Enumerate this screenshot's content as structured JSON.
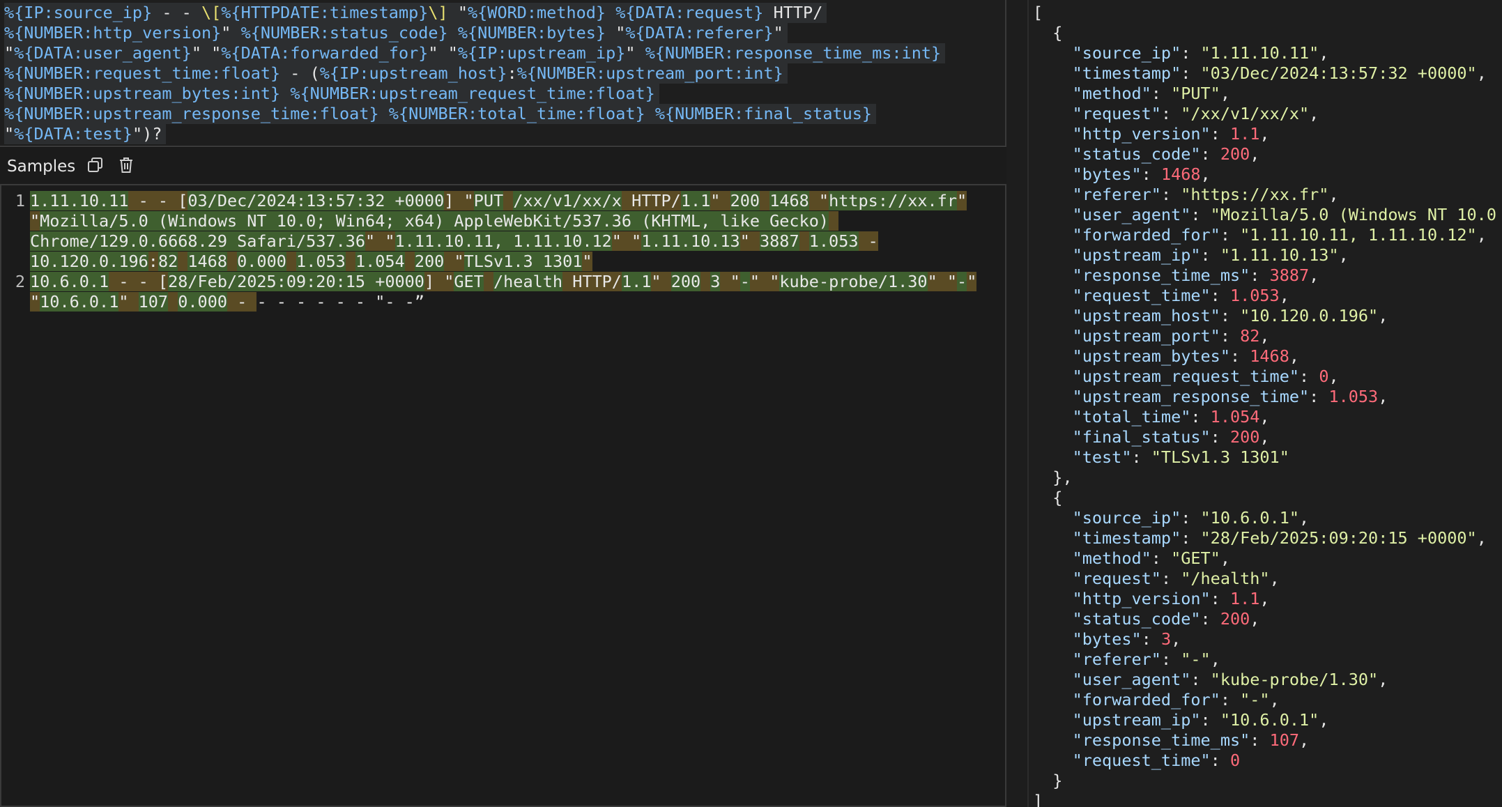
{
  "pattern": {
    "lines": [
      [
        [
          "g",
          "%{IP:source_ip}"
        ],
        [
          "t",
          " - - "
        ],
        [
          "esc",
          "\\["
        ],
        [
          "g",
          "%{HTTPDATE:timestamp}"
        ],
        [
          "esc",
          "\\]"
        ],
        [
          "t",
          " \""
        ],
        [
          "g",
          "%{WORD:method}"
        ],
        [
          "t",
          " "
        ],
        [
          "g",
          "%{DATA:request}"
        ],
        [
          "t",
          " HTTP/"
        ]
      ],
      [
        [
          "g",
          "%{NUMBER:http_version}"
        ],
        [
          "t",
          "\" "
        ],
        [
          "g",
          "%{NUMBER:status_code}"
        ],
        [
          "t",
          " "
        ],
        [
          "g",
          "%{NUMBER:bytes}"
        ],
        [
          "t",
          " \""
        ],
        [
          "g",
          "%{DATA:referer}"
        ],
        [
          "t",
          "\""
        ]
      ],
      [
        [
          "t",
          "\""
        ],
        [
          "g",
          "%{DATA:user_agent}"
        ],
        [
          "t",
          "\" \""
        ],
        [
          "g",
          "%{DATA:forwarded_for}"
        ],
        [
          "t",
          "\" \""
        ],
        [
          "g",
          "%{IP:upstream_ip}"
        ],
        [
          "t",
          "\" "
        ],
        [
          "g",
          "%{NUMBER:response_time_ms:int}"
        ]
      ],
      [
        [
          "g",
          "%{NUMBER:request_time:float}"
        ],
        [
          "t",
          " - ("
        ],
        [
          "g",
          "%{IP:upstream_host}"
        ],
        [
          "t",
          ":"
        ],
        [
          "g",
          "%{NUMBER:upstream_port:int}"
        ]
      ],
      [
        [
          "g",
          "%{NUMBER:upstream_bytes:int}"
        ],
        [
          "t",
          " "
        ],
        [
          "g",
          "%{NUMBER:upstream_request_time:float}"
        ]
      ],
      [
        [
          "g",
          "%{NUMBER:upstream_response_time:float}"
        ],
        [
          "t",
          " "
        ],
        [
          "g",
          "%{NUMBER:total_time:float}"
        ],
        [
          "t",
          " "
        ],
        [
          "g",
          "%{NUMBER:final_status}"
        ]
      ],
      [
        [
          "t",
          "\""
        ],
        [
          "g",
          "%{DATA:test}"
        ],
        [
          "t",
          "\")?"
        ]
      ]
    ]
  },
  "samples": {
    "title": "Samples",
    "copy_icon": "copy-icon",
    "delete_icon": "trash-icon",
    "entries": [
      {
        "number": "1",
        "lines": [
          [
            [
              "m",
              "1.11.10.11"
            ],
            [
              "s",
              " - - ["
            ],
            [
              "m",
              "03/Dec/2024:13:57:32 +0000"
            ],
            [
              "s",
              "] \""
            ],
            [
              "m",
              "PUT"
            ],
            [
              "s",
              " "
            ],
            [
              "m",
              "/xx/v1/xx/x"
            ],
            [
              "s",
              " HTTP/"
            ],
            [
              "m",
              "1.1"
            ],
            [
              "s",
              "\" "
            ],
            [
              "m",
              "200"
            ],
            [
              "s",
              " "
            ],
            [
              "m",
              "1468"
            ],
            [
              "s",
              " \""
            ],
            [
              "m",
              "https://xx.fr"
            ],
            [
              "s",
              "\""
            ]
          ],
          [
            [
              "s",
              "\""
            ],
            [
              "m",
              "Mozilla/5.0 (Windows NT 10.0; Win64; x64) AppleWebKit/537.36 (KHTML, like Gecko)"
            ],
            [
              "s",
              " "
            ]
          ],
          [
            [
              "m",
              "Chrome/129.0.6668.29 Safari/537.36"
            ],
            [
              "s",
              "\" \""
            ],
            [
              "m",
              "1.11.10.11, 1.11.10.12"
            ],
            [
              "s",
              "\" \""
            ],
            [
              "m",
              "1.11.10.13"
            ],
            [
              "s",
              "\" "
            ],
            [
              "m",
              "3887"
            ],
            [
              "s",
              " "
            ],
            [
              "m",
              "1.053"
            ],
            [
              "s",
              " -"
            ]
          ],
          [
            [
              "m",
              "10.120.0.196"
            ],
            [
              "s",
              ":"
            ],
            [
              "m",
              "82"
            ],
            [
              "s",
              " "
            ],
            [
              "m",
              "1468"
            ],
            [
              "s",
              " "
            ],
            [
              "m",
              "0.000"
            ],
            [
              "s",
              " "
            ],
            [
              "m",
              "1.053"
            ],
            [
              "s",
              " "
            ],
            [
              "m",
              "1.054"
            ],
            [
              "s",
              " "
            ],
            [
              "m",
              "200"
            ],
            [
              "s",
              " \""
            ],
            [
              "m",
              "TLSv1.3 1301"
            ],
            [
              "s",
              "\""
            ]
          ]
        ]
      },
      {
        "number": "2",
        "lines": [
          [
            [
              "m",
              "10.6.0.1"
            ],
            [
              "s",
              " - - ["
            ],
            [
              "m",
              "28/Feb/2025:09:20:15 +0000"
            ],
            [
              "s",
              "] \""
            ],
            [
              "m",
              "GET"
            ],
            [
              "s",
              " "
            ],
            [
              "m",
              "/health"
            ],
            [
              "s",
              " HTTP/"
            ],
            [
              "m",
              "1.1"
            ],
            [
              "s",
              "\" "
            ],
            [
              "m",
              "200"
            ],
            [
              "s",
              " "
            ],
            [
              "m",
              "3"
            ],
            [
              "s",
              " \""
            ],
            [
              "m",
              "-"
            ],
            [
              "s",
              "\" \""
            ],
            [
              "m",
              "kube-probe/1.30"
            ],
            [
              "s",
              "\" \""
            ],
            [
              "m",
              "-"
            ],
            [
              "s",
              "\""
            ]
          ],
          [
            [
              "s",
              "\""
            ],
            [
              "m",
              "10.6.0.1"
            ],
            [
              "s",
              "\" "
            ],
            [
              "m",
              "107"
            ],
            [
              "s",
              " "
            ],
            [
              "m",
              "0.000"
            ],
            [
              "s",
              " - "
            ],
            [
              "t",
              "- - - - - - \"- -”"
            ]
          ]
        ]
      }
    ]
  },
  "output": {
    "lines": [
      [
        [
          "t",
          "["
        ]
      ],
      [
        [
          "t",
          "  {"
        ]
      ],
      [
        [
          "t",
          "    "
        ],
        [
          "k",
          "\"source_ip\""
        ],
        [
          "t",
          ": "
        ],
        [
          "sv",
          "\"1.11.10.11\""
        ],
        [
          "t",
          ","
        ]
      ],
      [
        [
          "t",
          "    "
        ],
        [
          "k",
          "\"timestamp\""
        ],
        [
          "t",
          ": "
        ],
        [
          "sv",
          "\"03/Dec/2024:13:57:32 +0000\""
        ],
        [
          "t",
          ","
        ]
      ],
      [
        [
          "t",
          "    "
        ],
        [
          "k",
          "\"method\""
        ],
        [
          "t",
          ": "
        ],
        [
          "sv",
          "\"PUT\""
        ],
        [
          "t",
          ","
        ]
      ],
      [
        [
          "t",
          "    "
        ],
        [
          "k",
          "\"request\""
        ],
        [
          "t",
          ": "
        ],
        [
          "sv",
          "\"/xx/v1/xx/x\""
        ],
        [
          "t",
          ","
        ]
      ],
      [
        [
          "t",
          "    "
        ],
        [
          "k",
          "\"http_version\""
        ],
        [
          "t",
          ": "
        ],
        [
          "nv",
          "1.1"
        ],
        [
          "t",
          ","
        ]
      ],
      [
        [
          "t",
          "    "
        ],
        [
          "k",
          "\"status_code\""
        ],
        [
          "t",
          ": "
        ],
        [
          "nv",
          "200"
        ],
        [
          "t",
          ","
        ]
      ],
      [
        [
          "t",
          "    "
        ],
        [
          "k",
          "\"bytes\""
        ],
        [
          "t",
          ": "
        ],
        [
          "nv",
          "1468"
        ],
        [
          "t",
          ","
        ]
      ],
      [
        [
          "t",
          "    "
        ],
        [
          "k",
          "\"referer\""
        ],
        [
          "t",
          ": "
        ],
        [
          "sv",
          "\"https://xx.fr\""
        ],
        [
          "t",
          ","
        ]
      ],
      [
        [
          "t",
          "    "
        ],
        [
          "k",
          "\"user_agent\""
        ],
        [
          "t",
          ": "
        ],
        [
          "sv",
          "\"Mozilla/5.0 (Windows NT 10.0"
        ]
      ],
      [
        [
          "t",
          "    "
        ],
        [
          "k",
          "\"forwarded_for\""
        ],
        [
          "t",
          ": "
        ],
        [
          "sv",
          "\"1.11.10.11, 1.11.10.12\""
        ],
        [
          "t",
          ","
        ]
      ],
      [
        [
          "t",
          "    "
        ],
        [
          "k",
          "\"upstream_ip\""
        ],
        [
          "t",
          ": "
        ],
        [
          "sv",
          "\"1.11.10.13\""
        ],
        [
          "t",
          ","
        ]
      ],
      [
        [
          "t",
          "    "
        ],
        [
          "k",
          "\"response_time_ms\""
        ],
        [
          "t",
          ": "
        ],
        [
          "nv",
          "3887"
        ],
        [
          "t",
          ","
        ]
      ],
      [
        [
          "t",
          "    "
        ],
        [
          "k",
          "\"request_time\""
        ],
        [
          "t",
          ": "
        ],
        [
          "nv",
          "1.053"
        ],
        [
          "t",
          ","
        ]
      ],
      [
        [
          "t",
          "    "
        ],
        [
          "k",
          "\"upstream_host\""
        ],
        [
          "t",
          ": "
        ],
        [
          "sv",
          "\"10.120.0.196\""
        ],
        [
          "t",
          ","
        ]
      ],
      [
        [
          "t",
          "    "
        ],
        [
          "k",
          "\"upstream_port\""
        ],
        [
          "t",
          ": "
        ],
        [
          "nv",
          "82"
        ],
        [
          "t",
          ","
        ]
      ],
      [
        [
          "t",
          "    "
        ],
        [
          "k",
          "\"upstream_bytes\""
        ],
        [
          "t",
          ": "
        ],
        [
          "nv",
          "1468"
        ],
        [
          "t",
          ","
        ]
      ],
      [
        [
          "t",
          "    "
        ],
        [
          "k",
          "\"upstream_request_time\""
        ],
        [
          "t",
          ": "
        ],
        [
          "nv",
          "0"
        ],
        [
          "t",
          ","
        ]
      ],
      [
        [
          "t",
          "    "
        ],
        [
          "k",
          "\"upstream_response_time\""
        ],
        [
          "t",
          ": "
        ],
        [
          "nv",
          "1.053"
        ],
        [
          "t",
          ","
        ]
      ],
      [
        [
          "t",
          "    "
        ],
        [
          "k",
          "\"total_time\""
        ],
        [
          "t",
          ": "
        ],
        [
          "nv",
          "1.054"
        ],
        [
          "t",
          ","
        ]
      ],
      [
        [
          "t",
          "    "
        ],
        [
          "k",
          "\"final_status\""
        ],
        [
          "t",
          ": "
        ],
        [
          "nv",
          "200"
        ],
        [
          "t",
          ","
        ]
      ],
      [
        [
          "t",
          "    "
        ],
        [
          "k",
          "\"test\""
        ],
        [
          "t",
          ": "
        ],
        [
          "sv",
          "\"TLSv1.3 1301\""
        ]
      ],
      [
        [
          "t",
          "  },"
        ]
      ],
      [
        [
          "t",
          "  {"
        ]
      ],
      [
        [
          "t",
          "    "
        ],
        [
          "k",
          "\"source_ip\""
        ],
        [
          "t",
          ": "
        ],
        [
          "sv",
          "\"10.6.0.1\""
        ],
        [
          "t",
          ","
        ]
      ],
      [
        [
          "t",
          "    "
        ],
        [
          "k",
          "\"timestamp\""
        ],
        [
          "t",
          ": "
        ],
        [
          "sv",
          "\"28/Feb/2025:09:20:15 +0000\""
        ],
        [
          "t",
          ","
        ]
      ],
      [
        [
          "t",
          "    "
        ],
        [
          "k",
          "\"method\""
        ],
        [
          "t",
          ": "
        ],
        [
          "sv",
          "\"GET\""
        ],
        [
          "t",
          ","
        ]
      ],
      [
        [
          "t",
          "    "
        ],
        [
          "k",
          "\"request\""
        ],
        [
          "t",
          ": "
        ],
        [
          "sv",
          "\"/health\""
        ],
        [
          "t",
          ","
        ]
      ],
      [
        [
          "t",
          "    "
        ],
        [
          "k",
          "\"http_version\""
        ],
        [
          "t",
          ": "
        ],
        [
          "nv",
          "1.1"
        ],
        [
          "t",
          ","
        ]
      ],
      [
        [
          "t",
          "    "
        ],
        [
          "k",
          "\"status_code\""
        ],
        [
          "t",
          ": "
        ],
        [
          "nv",
          "200"
        ],
        [
          "t",
          ","
        ]
      ],
      [
        [
          "t",
          "    "
        ],
        [
          "k",
          "\"bytes\""
        ],
        [
          "t",
          ": "
        ],
        [
          "nv",
          "3"
        ],
        [
          "t",
          ","
        ]
      ],
      [
        [
          "t",
          "    "
        ],
        [
          "k",
          "\"referer\""
        ],
        [
          "t",
          ": "
        ],
        [
          "sv",
          "\"-\""
        ],
        [
          "t",
          ","
        ]
      ],
      [
        [
          "t",
          "    "
        ],
        [
          "k",
          "\"user_agent\""
        ],
        [
          "t",
          ": "
        ],
        [
          "sv",
          "\"kube-probe/1.30\""
        ],
        [
          "t",
          ","
        ]
      ],
      [
        [
          "t",
          "    "
        ],
        [
          "k",
          "\"forwarded_for\""
        ],
        [
          "t",
          ": "
        ],
        [
          "sv",
          "\"-\""
        ],
        [
          "t",
          ","
        ]
      ],
      [
        [
          "t",
          "    "
        ],
        [
          "k",
          "\"upstream_ip\""
        ],
        [
          "t",
          ": "
        ],
        [
          "sv",
          "\"10.6.0.1\""
        ],
        [
          "t",
          ","
        ]
      ],
      [
        [
          "t",
          "    "
        ],
        [
          "k",
          "\"response_time_ms\""
        ],
        [
          "t",
          ": "
        ],
        [
          "nv",
          "107"
        ],
        [
          "t",
          ","
        ]
      ],
      [
        [
          "t",
          "    "
        ],
        [
          "k",
          "\"request_time\""
        ],
        [
          "t",
          ": "
        ],
        [
          "nv",
          "0"
        ]
      ],
      [
        [
          "t",
          "  }"
        ]
      ],
      [
        [
          "t",
          "]"
        ]
      ]
    ]
  }
}
